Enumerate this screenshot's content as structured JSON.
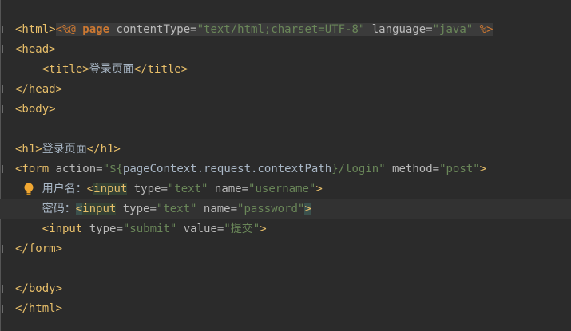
{
  "editor": {
    "lines": [
      {
        "parts": [
          "<%@ ",
          "page",
          " contentType=",
          "\"text/html;charset=UTF-8\"",
          " language=",
          "\"java\"",
          " %>"
        ]
      },
      {
        "parts": [
          "<html>"
        ]
      },
      {
        "parts": [
          "<head>"
        ]
      },
      {
        "parts": [
          "    ",
          "<title>",
          "登录页面",
          "</title>"
        ]
      },
      {
        "parts": [
          "</head>"
        ]
      },
      {
        "parts": [
          "<body>"
        ]
      },
      {
        "parts": [
          ""
        ]
      },
      {
        "parts": [
          "<h1>",
          "登录页面",
          "</h1>"
        ]
      },
      {
        "parts": [
          "<form",
          " action=",
          "\"${",
          "pageContext.request.contextPath",
          "}/login\"",
          " method=",
          "\"post\"",
          ">"
        ]
      },
      {
        "parts": [
          "    ",
          "用户名：",
          "<",
          "input",
          " type=",
          "\"text\"",
          " name=",
          "\"username\"",
          ">"
        ]
      },
      {
        "parts": [
          "    ",
          "密码：",
          "<",
          "input",
          " type=",
          "\"text\"",
          " name=",
          "\"password\"",
          ">"
        ]
      },
      {
        "parts": [
          "    ",
          "<input",
          " type=",
          "\"submit\"",
          " value=",
          "\"提交\"",
          ">"
        ]
      },
      {
        "parts": [
          "</form>"
        ]
      },
      {
        "parts": [
          ""
        ]
      },
      {
        "parts": [
          "</body>"
        ]
      },
      {
        "parts": [
          "</html>"
        ]
      }
    ],
    "lightbulb_icon": "lightbulb-icon",
    "colors": {
      "background": "#2b2b2b",
      "tag": "#e8bf6a",
      "keyword": "#cc7832",
      "string": "#6a8759",
      "text": "#a9b7c6",
      "current_line": "#323232"
    }
  }
}
